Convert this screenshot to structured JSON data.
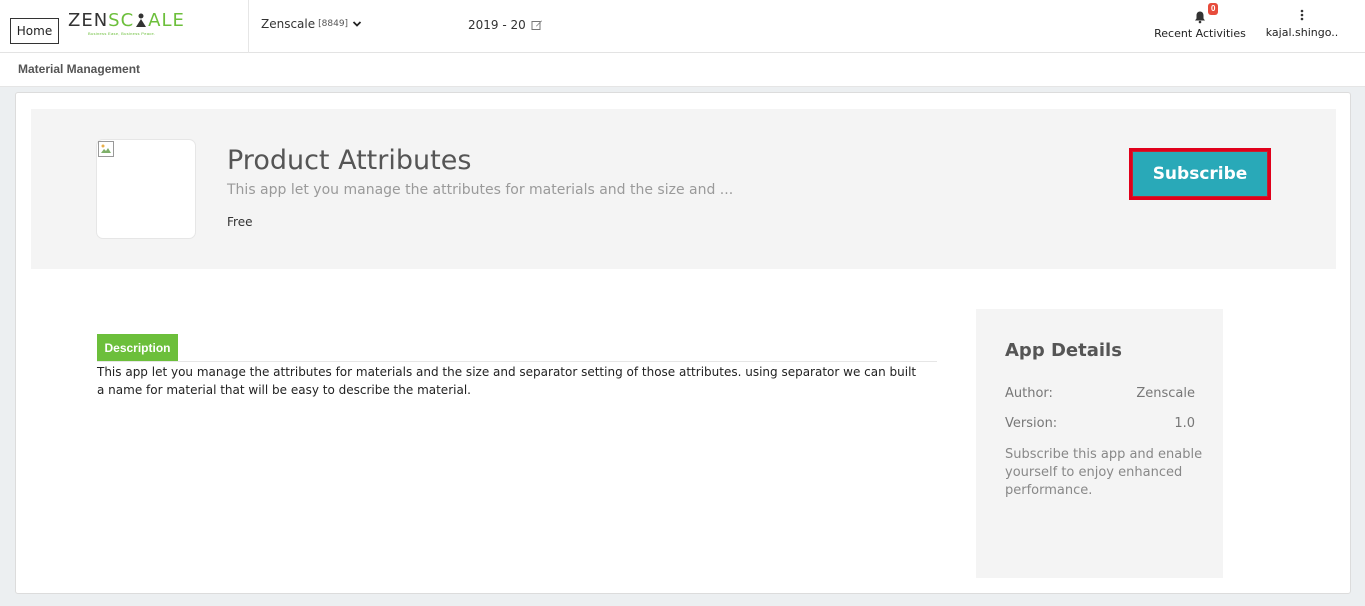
{
  "header": {
    "home_label": "Home",
    "logo_text_a": "ZEN",
    "logo_text_b": "SC",
    "logo_text_c": "ALE",
    "logo_tagline": "Business Ease, Business Peace.",
    "company_name": "Zenscale",
    "company_code": "[8849]",
    "fiscal_year": "2019 - 20",
    "notification_count": "0",
    "recent_activities_label": "Recent Activities",
    "user_label": "kajal.shingo.."
  },
  "breadcrumb": {
    "title": "Material Management"
  },
  "app": {
    "title": "Product Attributes",
    "subtitle": "This app let you manage the attributes for materials and the size and ...",
    "price": "Free",
    "subscribe_label": "Subscribe"
  },
  "description": {
    "tab_label": "Description",
    "text": "This app let you manage the attributes for materials and the size and separator setting of those attributes. using separator we can built a name for material that will be easy to describe the material."
  },
  "app_details": {
    "heading": "App Details",
    "author_label": "Author:",
    "author_value": "Zenscale",
    "version_label": "Version:",
    "version_value": "1.0",
    "note": "Subscribe this app and enable yourself to enjoy enhanced performance."
  },
  "colors": {
    "accent_teal": "#29a9b8",
    "accent_green": "#6cbf3b",
    "highlight_red": "#e0001b",
    "badge_red": "#e74c3c"
  },
  "icons": [
    "chevron-down-icon",
    "edit-icon",
    "bell-icon",
    "vertical-dots-icon",
    "broken-image-icon"
  ]
}
